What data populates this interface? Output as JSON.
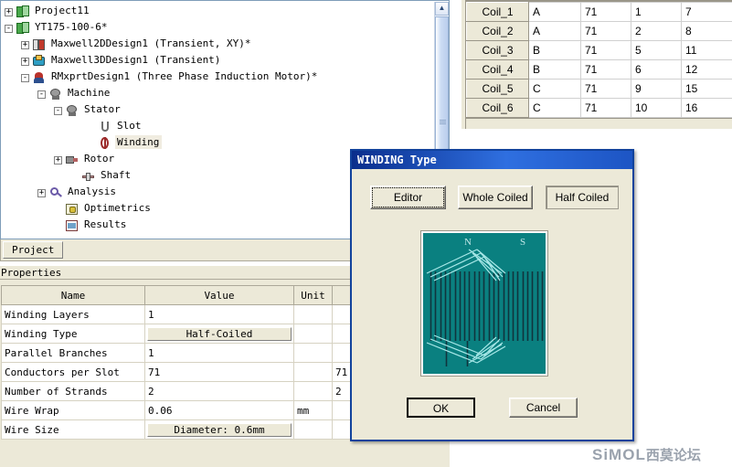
{
  "tree": {
    "items": [
      {
        "label": "Project11",
        "expander": "+",
        "icon": "project-icon",
        "indent": 4,
        "selected": false
      },
      {
        "label": "YT175-100-6*",
        "expander": "-",
        "icon": "project-icon",
        "indent": 4,
        "selected": false
      },
      {
        "label": "Maxwell2DDesign1 (Transient, XY)*",
        "expander": "+",
        "icon": "maxwell2d-icon",
        "indent": 22,
        "selected": false
      },
      {
        "label": "Maxwell3DDesign1 (Transient)",
        "expander": "+",
        "icon": "maxwell3d-icon",
        "indent": 22,
        "selected": false
      },
      {
        "label": "RMxprtDesign1 (Three Phase Induction Motor)*",
        "expander": "-",
        "icon": "rmxprt-icon",
        "indent": 22,
        "selected": false
      },
      {
        "label": "Machine",
        "expander": "-",
        "icon": "machine-icon",
        "indent": 40,
        "selected": false
      },
      {
        "label": "Stator",
        "expander": "-",
        "icon": "stator-icon",
        "indent": 58,
        "selected": false
      },
      {
        "label": "Slot",
        "expander": "",
        "icon": "slot-icon",
        "indent": 94,
        "selected": false
      },
      {
        "label": "Winding",
        "expander": "",
        "icon": "winding-icon",
        "indent": 94,
        "selected": true
      },
      {
        "label": "Rotor",
        "expander": "+",
        "icon": "rotor-icon",
        "indent": 58,
        "selected": false
      },
      {
        "label": "Shaft",
        "expander": "",
        "icon": "shaft-icon",
        "indent": 76,
        "selected": false
      },
      {
        "label": "Analysis",
        "expander": "+",
        "icon": "analysis-icon",
        "indent": 40,
        "selected": false
      },
      {
        "label": "Optimetrics",
        "expander": "",
        "icon": "optimetrics-icon",
        "indent": 58,
        "selected": false
      },
      {
        "label": "Results",
        "expander": "",
        "icon": "results-icon",
        "indent": 58,
        "selected": false
      }
    ],
    "scroll_up_glyph": "▲"
  },
  "tabs": {
    "project_tab": "Project"
  },
  "properties": {
    "caption": "Properties",
    "columns": [
      "Name",
      "Value",
      "Unit",
      ""
    ],
    "rows": [
      {
        "name": "Winding Layers",
        "value": "1",
        "value_is_button": false,
        "unit": "",
        "extra": ""
      },
      {
        "name": "Winding Type",
        "value": "Half-Coiled",
        "value_is_button": true,
        "unit": "",
        "extra": ""
      },
      {
        "name": "Parallel Branches",
        "value": "1",
        "value_is_button": false,
        "unit": "",
        "extra": ""
      },
      {
        "name": "Conductors per Slot",
        "value": "71",
        "value_is_button": false,
        "unit": "",
        "extra": "71"
      },
      {
        "name": "Number of Strands",
        "value": "2",
        "value_is_button": false,
        "unit": "",
        "extra": "2"
      },
      {
        "name": "Wire Wrap",
        "value": "0.06",
        "value_is_button": false,
        "unit": "mm",
        "extra": ""
      },
      {
        "name": "Wire Size",
        "value": "Diameter:  0.6mm",
        "value_is_button": true,
        "unit": "",
        "extra": ""
      }
    ]
  },
  "coil_table": {
    "rows": [
      {
        "name": "Coil_1",
        "phase": "A",
        "turns": "71",
        "in_slot": "1",
        "out_slot": "7"
      },
      {
        "name": "Coil_2",
        "phase": "A",
        "turns": "71",
        "in_slot": "2",
        "out_slot": "8"
      },
      {
        "name": "Coil_3",
        "phase": "B",
        "turns": "71",
        "in_slot": "5",
        "out_slot": "11"
      },
      {
        "name": "Coil_4",
        "phase": "B",
        "turns": "71",
        "in_slot": "6",
        "out_slot": "12"
      },
      {
        "name": "Coil_5",
        "phase": "C",
        "turns": "71",
        "in_slot": "9",
        "out_slot": "15"
      },
      {
        "name": "Coil_6",
        "phase": "C",
        "turns": "71",
        "in_slot": "10",
        "out_slot": "16"
      }
    ]
  },
  "dialog": {
    "title": "WINDING Type",
    "buttons": {
      "editor": "Editor",
      "whole_coiled": "Whole Coiled",
      "half_coiled": "Half Coiled",
      "ok": "OK",
      "cancel": "Cancel"
    },
    "diagram": {
      "pole_north": "N",
      "pole_south": "S",
      "background_color": "#0a8080",
      "slot_line_color": "#10343d",
      "coil_line_color": "#a8e8e8",
      "slot_count": 24
    }
  },
  "watermark": {
    "brand": "SiMOL",
    "cn": "西莫论坛"
  },
  "colors": {
    "dialog_border": "#11429c",
    "title_bar": "#2f6fe0",
    "panel_face": "#ece9d8",
    "tree_selection": "#f0ece0"
  }
}
